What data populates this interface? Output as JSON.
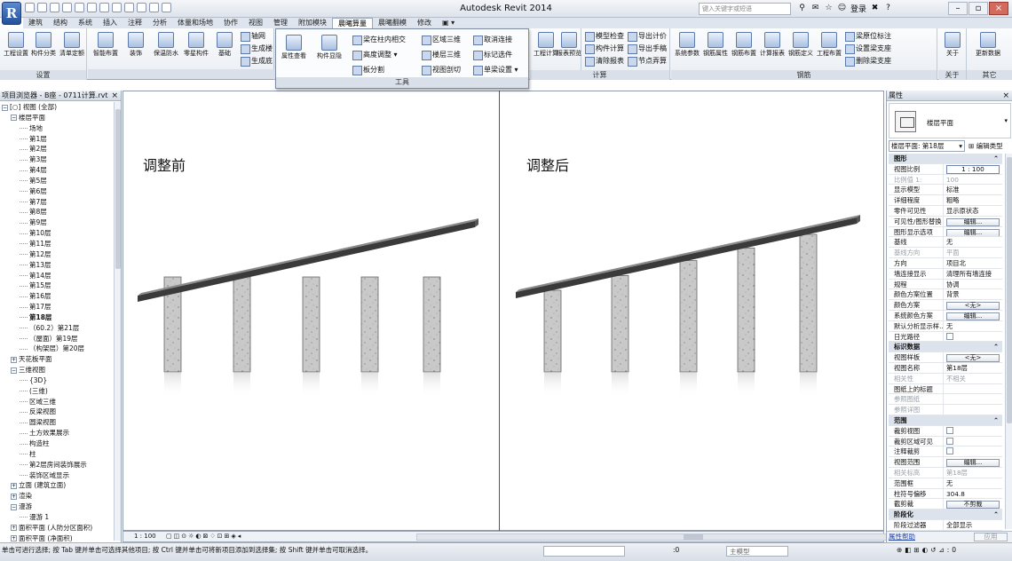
{
  "window": {
    "app_title": "Autodesk Revit 2014",
    "search_placeholder": "键入关键字或短语",
    "login": "登录",
    "minimize": "–",
    "restore": "▫",
    "close": "×",
    "help": "?"
  },
  "app_button": "R",
  "tabs": [
    "建筑",
    "结构",
    "系统",
    "插入",
    "注释",
    "分析",
    "体量和场地",
    "协作",
    "视图",
    "管理",
    "附加模块",
    "晨曦算量",
    "晨曦翻模",
    "修改"
  ],
  "active_tab": "晨曦算量",
  "ribbon": {
    "settings": {
      "title": "设置",
      "buttons": [
        "工程设置",
        "构件分类",
        "清单定额"
      ]
    },
    "build": {
      "buttons": [
        "智能布置",
        "装饰",
        "保温防水",
        "零星构件",
        "基础"
      ],
      "small": [
        "轴网",
        "生成楼",
        "生成底"
      ]
    },
    "tools": {
      "title": "工具",
      "big": [
        "属性查看",
        "构件显隐"
      ],
      "small": [
        "梁在柱内相交",
        "高度调整 ▾",
        "板分割",
        "区域三维",
        "楼层三维",
        "视图剖切",
        "取消连接",
        "标记选件",
        "单梁设置 ▾"
      ]
    },
    "calc": {
      "title": "计算",
      "big": [
        "工程计算",
        "报表预览"
      ],
      "small": [
        "模型检查",
        "构件计算",
        "清除报表",
        "导出计价",
        "导出手稿",
        "节点弄算"
      ]
    },
    "rebar": {
      "title": "钢筋",
      "big": [
        "系统参数",
        "钢筋属性",
        "钢筋布置",
        "计算报表",
        "钢筋定义",
        "工程布置"
      ],
      "small": [
        "梁原位标注",
        "设置梁支座",
        "删除梁支座"
      ]
    },
    "about": {
      "title": "关于",
      "big": "关于"
    },
    "other": {
      "title": "其它",
      "big": "更新数据"
    }
  },
  "browser": {
    "title": "项目浏览器 - B座 - 0711计算.rvt",
    "close": "×",
    "items": [
      {
        "t": "[○] 视图 (全部)",
        "lvl": 0,
        "tg": "−"
      },
      {
        "t": "楼层平面",
        "lvl": 1,
        "tg": "−"
      },
      {
        "t": "场地",
        "lvl": 2
      },
      {
        "t": "第1层",
        "lvl": 2
      },
      {
        "t": "第2层",
        "lvl": 2
      },
      {
        "t": "第3层",
        "lvl": 2
      },
      {
        "t": "第4层",
        "lvl": 2
      },
      {
        "t": "第5层",
        "lvl": 2
      },
      {
        "t": "第6层",
        "lvl": 2
      },
      {
        "t": "第7层",
        "lvl": 2
      },
      {
        "t": "第8层",
        "lvl": 2
      },
      {
        "t": "第9层",
        "lvl": 2
      },
      {
        "t": "第10层",
        "lvl": 2
      },
      {
        "t": "第11层",
        "lvl": 2
      },
      {
        "t": "第12层",
        "lvl": 2
      },
      {
        "t": "第13层",
        "lvl": 2
      },
      {
        "t": "第14层",
        "lvl": 2
      },
      {
        "t": "第15层",
        "lvl": 2
      },
      {
        "t": "第16层",
        "lvl": 2
      },
      {
        "t": "第17层",
        "lvl": 2
      },
      {
        "t": "第18层",
        "lvl": 2,
        "bold": true
      },
      {
        "t": "（60.2）第21层",
        "lvl": 2
      },
      {
        "t": "（屋面）第19层",
        "lvl": 2
      },
      {
        "t": "（构架层）第20层",
        "lvl": 2
      },
      {
        "t": "天花板平面",
        "lvl": 1,
        "tg": "+"
      },
      {
        "t": "三维视图",
        "lvl": 1,
        "tg": "−"
      },
      {
        "t": "{3D}",
        "lvl": 2
      },
      {
        "t": "(三维)",
        "lvl": 2
      },
      {
        "t": "区域三维",
        "lvl": 2
      },
      {
        "t": "反梁视图",
        "lvl": 2
      },
      {
        "t": "圆梁视图",
        "lvl": 2
      },
      {
        "t": "土方效果展示",
        "lvl": 2
      },
      {
        "t": "构造柱",
        "lvl": 2
      },
      {
        "t": "柱",
        "lvl": 2
      },
      {
        "t": "第2层房间装饰展示",
        "lvl": 2
      },
      {
        "t": "装饰区域显示",
        "lvl": 2
      },
      {
        "t": "立面 (建筑立面)",
        "lvl": 1,
        "tg": "+"
      },
      {
        "t": "渲染",
        "lvl": 1,
        "tg": "+"
      },
      {
        "t": "漫游",
        "lvl": 1,
        "tg": "−"
      },
      {
        "t": "漫游 1",
        "lvl": 2
      },
      {
        "t": "面积平面 (人防分区面积)",
        "lvl": 1,
        "tg": "+"
      },
      {
        "t": "面积平面 (净面积)",
        "lvl": 1,
        "tg": "+"
      }
    ]
  },
  "view": {
    "before_label": "调整前",
    "after_label": "调整后",
    "scale": "1 : 100"
  },
  "properties": {
    "title": "属性",
    "close": "×",
    "type_name": "楼层平面",
    "instance": "楼层平面: 第18层",
    "edit_type": "编辑类型",
    "rows": [
      {
        "sec": "图形"
      },
      {
        "k": "视图比例",
        "v": "1 : 100",
        "kind": "input"
      },
      {
        "k": "比例值 1:",
        "v": "100",
        "dim": true
      },
      {
        "k": "显示模型",
        "v": "标准"
      },
      {
        "k": "详细程度",
        "v": "粗略"
      },
      {
        "k": "零件可见性",
        "v": "显示原状态"
      },
      {
        "k": "可见性/图形替换",
        "v": "编辑...",
        "kind": "btn"
      },
      {
        "k": "图形显示选项",
        "v": "编辑...",
        "kind": "btn"
      },
      {
        "k": "基线",
        "v": "无"
      },
      {
        "k": "基线方向",
        "v": "平面",
        "dim": true
      },
      {
        "k": "方向",
        "v": "项目北"
      },
      {
        "k": "墙连接显示",
        "v": "清理所有墙连接"
      },
      {
        "k": "规程",
        "v": "协调"
      },
      {
        "k": "颜色方案位置",
        "v": "背景"
      },
      {
        "k": "颜色方案",
        "v": "<无>",
        "kind": "btn"
      },
      {
        "k": "系统颜色方案",
        "v": "编辑...",
        "kind": "btn"
      },
      {
        "k": "默认分析显示样...",
        "v": "无"
      },
      {
        "k": "日光路径",
        "v": "",
        "kind": "chk"
      },
      {
        "sec": "标识数据"
      },
      {
        "k": "视图样板",
        "v": "<无>",
        "kind": "btn"
      },
      {
        "k": "视图名称",
        "v": "第18层"
      },
      {
        "k": "相关性",
        "v": "不相关",
        "dim": true
      },
      {
        "k": "图纸上的标题",
        "v": ""
      },
      {
        "k": "参照图纸",
        "v": "",
        "dim": true
      },
      {
        "k": "参照详图",
        "v": "",
        "dim": true
      },
      {
        "sec": "范围"
      },
      {
        "k": "裁剪视图",
        "v": "",
        "kind": "chk"
      },
      {
        "k": "裁剪区域可见",
        "v": "",
        "kind": "chk"
      },
      {
        "k": "注释裁剪",
        "v": "",
        "kind": "chk"
      },
      {
        "k": "视图范围",
        "v": "编辑...",
        "kind": "btn"
      },
      {
        "k": "相关标高",
        "v": "第18层",
        "dim": true
      },
      {
        "k": "范围框",
        "v": "无"
      },
      {
        "k": "柱符号偏移",
        "v": "304.8"
      },
      {
        "k": "截剪裁",
        "v": "不剪裁",
        "kind": "btn"
      },
      {
        "sec": "阶段化"
      },
      {
        "k": "阶段过滤器",
        "v": "全部显示"
      }
    ],
    "help": "属性帮助",
    "apply": "应用"
  },
  "status": {
    "message": "单击可进行选择; 按 Tab 键并单击可选择其他项目; 按 Ctrl 键并单击可将新项目添加到选择集; 按 Shift 键并单击可取消选择。",
    "zero": ":0",
    "model": "主模型"
  }
}
